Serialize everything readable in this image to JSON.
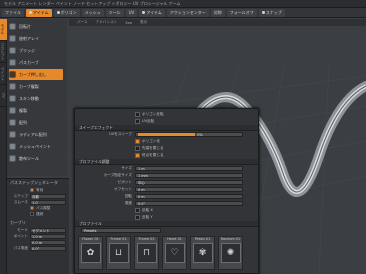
{
  "topbar": {
    "title": "モデル  アニメート  レンダー  ペイント  ノード  セットアップ  トポロジー  UV  プロシージャル  ゲーム"
  },
  "toolbar": {
    "items": [
      {
        "label": "ファイル"
      },
      {
        "label": "アイテム"
      },
      {
        "label": "ポリゴン"
      },
      {
        "label": "メッシュ"
      },
      {
        "label": "ツール"
      },
      {
        "label": "UV"
      },
      {
        "label": "アイテム"
      },
      {
        "label": "アクションセンター"
      },
      {
        "label": "対称"
      },
      {
        "label": "フォールオフ"
      },
      {
        "label": "スナップ"
      }
    ]
  },
  "left_strip": {
    "tabs": [
      "モデル",
      "スカルプト",
      "ペイント",
      "UV"
    ]
  },
  "left_panel": {
    "tools": [
      {
        "label": "回転片"
      },
      {
        "label": "放射アレイ"
      },
      {
        "label": "ブリッジ"
      },
      {
        "label": "パスカーブ"
      },
      {
        "label": "カーブ押し出し",
        "selected": true
      },
      {
        "label": "カーブ複製"
      },
      {
        "label": "スキン移動"
      },
      {
        "label": "複製"
      },
      {
        "label": "配列"
      },
      {
        "label": "ラディアル配列"
      },
      {
        "label": "メッシュペイント"
      },
      {
        "label": "散布ツール"
      }
    ]
  },
  "props": {
    "section1": "パスステップジェネレータ",
    "rows": [
      {
        "label": "有効",
        "value": ""
      },
      {
        "label": "ステップ",
        "value": "自動"
      },
      {
        "label": "スムース",
        "value": "1.0"
      },
      {
        "label": "パス調整",
        "value": ""
      },
      {
        "label": "連続",
        "value": ""
      }
    ],
    "section2": "カーブリ",
    "rows2": [
      {
        "label": "モード",
        "value": "セグメント"
      },
      {
        "label": "ポイント",
        "value": "1.0 m"
      },
      {
        "label": "",
        "value": "0.0 m"
      },
      {
        "label": "パス角度",
        "value": "0.0°"
      }
    ]
  },
  "viewport": {
    "tabs": [
      "パース",
      "アドバンスト",
      "Xeo",
      "表示"
    ]
  },
  "dialog": {
    "row_top1": "ポリゴン反転",
    "row_top2": "UV反転",
    "section_sweep": "スイープエフェクト",
    "uv_label": "UVをスイープ",
    "uv_value": "0%",
    "uv_fill": 0.55,
    "checks": [
      {
        "label": "ポリゴン化",
        "on": true
      },
      {
        "label": "先端を閉じる",
        "on": false
      },
      {
        "label": "終点を閉じる",
        "on": true
      }
    ],
    "section_profile": "プロファイル調整",
    "fields": [
      {
        "label": "サイズ",
        "value": "1 m"
      },
      {
        "label": "カーブ指定サイズ",
        "value": "1 mm"
      },
      {
        "label": "ピボット",
        "value": "中心"
      },
      {
        "label": "オフセット",
        "value": "0 m"
      },
      {
        "label": "回転",
        "value": "0 m"
      },
      {
        "label": "角度",
        "value": "0.0°"
      }
    ],
    "flip_checks": [
      {
        "label": "反転 X",
        "on": false
      },
      {
        "label": "反転 Y",
        "on": false
      }
    ],
    "section_presets": "プロファイル",
    "preset_filter": "Presets",
    "presets": [
      {
        "name": "Flower 01",
        "glyph": "✿"
      },
      {
        "name": "Frame 01",
        "glyph": "⊔"
      },
      {
        "name": "Frame 02",
        "glyph": "⊓"
      },
      {
        "name": "Heart 01",
        "glyph": "♡"
      },
      {
        "name": "Petals 01",
        "glyph": "✾"
      },
      {
        "name": "Random 01",
        "glyph": "✺"
      }
    ]
  },
  "colors": {
    "accent": "#e6892a",
    "panel": "#36383b",
    "viewport": "#3b3f43"
  }
}
